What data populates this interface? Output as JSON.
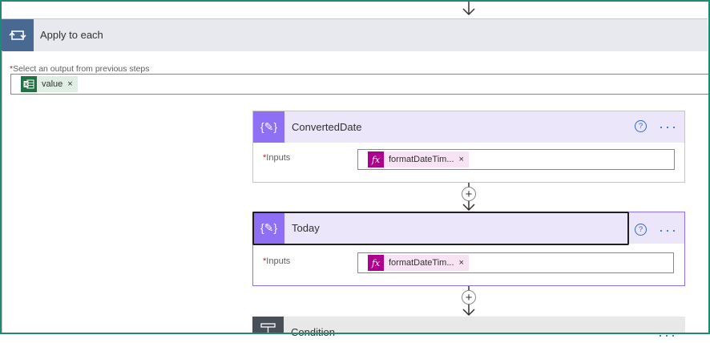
{
  "apply_to_each": {
    "title": "Apply to each",
    "select_label": "Select an output from previous steps",
    "required_marker": "*",
    "token": {
      "label": "value",
      "icon": "excel-icon",
      "remove": "×"
    }
  },
  "actions": [
    {
      "title": "ConvertedDate",
      "icon": "variable-icon",
      "icon_glyph": "{✎}",
      "help": "?",
      "more": "···",
      "inputs_label": "Inputs",
      "required_marker": "*",
      "expression": {
        "label": "formatDateTim...",
        "icon": "fx-icon",
        "icon_glyph": "fx",
        "remove": "×"
      }
    },
    {
      "title": "Today",
      "icon": "variable-icon",
      "icon_glyph": "{✎}",
      "help": "?",
      "more": "···",
      "inputs_label": "Inputs",
      "required_marker": "*",
      "expression": {
        "label": "formatDateTim...",
        "icon": "fx-icon",
        "icon_glyph": "fx",
        "remove": "×"
      }
    }
  ],
  "condition": {
    "title": "Condition",
    "icon": "condition-icon"
  },
  "add_step": "+",
  "colors": {
    "accent_blue": "#486991",
    "variable_purple": "#8f70f5",
    "expression_magenta": "#ad008c",
    "excel_green": "#217346",
    "frame_teal": "#1e8a76"
  }
}
